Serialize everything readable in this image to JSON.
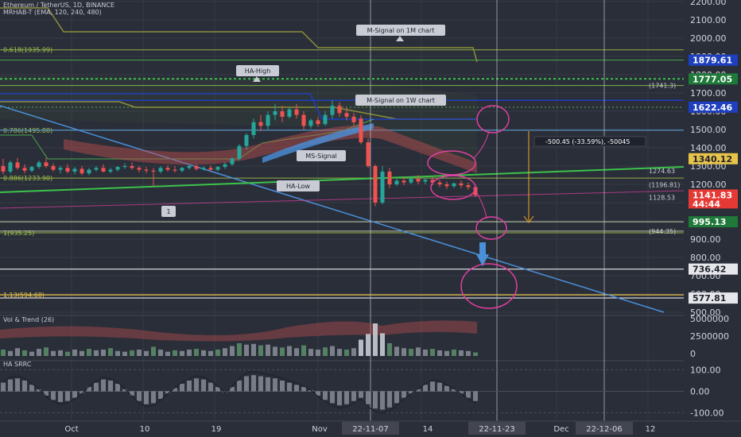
{
  "header": {
    "title": "Ethereum / TetherUS, 1D, BINANCE",
    "indicator": "MRHAB-T (EMA, 120, 240, 480)"
  },
  "colors": {
    "bg": "#2a2e39",
    "up": "#26a69a",
    "down": "#ef5350",
    "grid": "#363a45",
    "fib": "#a5c64a",
    "gold": "#e8c34a",
    "blue": "#1e3fbf",
    "trend": "#4a90d9",
    "magenta": "#e040a0",
    "ma_green": "#3cc24a",
    "crosshair": "#c0c4cc"
  },
  "chart_data": [
    {
      "type": "candlestick",
      "title": "Ethereum / TetherUS, 1D, BINANCE",
      "y_ticks": [
        500,
        600,
        700,
        800,
        900,
        1000,
        1100,
        1200,
        1300,
        1400,
        1500,
        1600,
        1700,
        1800,
        1900,
        2000,
        2100,
        2200
      ],
      "y_tick_labels": [
        "500.00",
        "600.00",
        "700.00",
        "800.00",
        "900.00",
        "1000.00",
        "1100.00",
        "1200.00",
        "1300.00",
        "1400.00",
        "1500.00",
        "1600.00",
        "1700.00",
        "1800.00",
        "1900.00",
        "2000.00",
        "2100.00",
        "2200.00"
      ],
      "ylim": [
        500,
        2220
      ],
      "x_labels": [
        "Oct",
        "10",
        "19",
        "Nov",
        "14",
        "Dec",
        "12"
      ],
      "x_highlight_labels": [
        "22-11-07",
        "22-11-23",
        "22-12-06"
      ],
      "price_badges": [
        {
          "value": "1879.61",
          "style": "blue"
        },
        {
          "value": "1777.05",
          "style": "green"
        },
        {
          "value": "1622.46",
          "style": "blue"
        },
        {
          "value": "1340.12",
          "style": "gold"
        },
        {
          "value": "1141.83",
          "sub": "44:44",
          "style": "red"
        },
        {
          "value": "995.13",
          "style": "green"
        },
        {
          "value": "736.42",
          "style": "light"
        },
        {
          "value": "577.81",
          "style": "light"
        }
      ],
      "fib_levels": [
        {
          "label": "0.618(1935.99)",
          "value": 1936
        },
        {
          "label": "0.786(1495.88)",
          "value": 1496
        },
        {
          "label": "0.886(1233.90)",
          "value": 1234
        },
        {
          "label": "1(935.25)",
          "value": 935
        },
        {
          "label": "1.13(594.68)",
          "value": 595
        }
      ],
      "line_labels": [
        {
          "text": "(1741.3)",
          "value": 1741
        },
        {
          "text": "1274.63",
          "value": 1275
        },
        {
          "text": "(1196.81)",
          "value": 1197
        },
        {
          "text": "1128.53",
          "value": 1129
        },
        {
          "text": "(944.35)",
          "value": 944
        }
      ],
      "callouts": [
        "M-Signal on 1M chart",
        "HA-High",
        "M-Signal on 1W chart",
        "MS-Signal",
        "HA-Low",
        "1"
      ],
      "measure_label": "-500.45 (-33.59%), -50045",
      "candles": [
        {
          "o": 1300,
          "h": 1340,
          "c": 1270,
          "l": 1255
        },
        {
          "o": 1270,
          "h": 1330,
          "c": 1320,
          "l": 1260
        },
        {
          "o": 1320,
          "h": 1345,
          "c": 1290,
          "l": 1280
        },
        {
          "o": 1290,
          "h": 1310,
          "c": 1275,
          "l": 1260
        },
        {
          "o": 1275,
          "h": 1300,
          "c": 1295,
          "l": 1265
        },
        {
          "o": 1295,
          "h": 1330,
          "c": 1320,
          "l": 1285
        },
        {
          "o": 1320,
          "h": 1345,
          "c": 1300,
          "l": 1290
        },
        {
          "o": 1300,
          "h": 1315,
          "c": 1280,
          "l": 1270
        },
        {
          "o": 1280,
          "h": 1300,
          "c": 1290,
          "l": 1260
        },
        {
          "o": 1290,
          "h": 1310,
          "c": 1270,
          "l": 1260
        },
        {
          "o": 1270,
          "h": 1295,
          "c": 1285,
          "l": 1255
        },
        {
          "o": 1285,
          "h": 1300,
          "c": 1260,
          "l": 1250
        },
        {
          "o": 1260,
          "h": 1290,
          "c": 1280,
          "l": 1250
        },
        {
          "o": 1280,
          "h": 1300,
          "c": 1290,
          "l": 1270
        },
        {
          "o": 1290,
          "h": 1310,
          "c": 1270,
          "l": 1265
        },
        {
          "o": 1270,
          "h": 1290,
          "c": 1280,
          "l": 1260
        },
        {
          "o": 1280,
          "h": 1300,
          "c": 1295,
          "l": 1270
        },
        {
          "o": 1295,
          "h": 1315,
          "c": 1300,
          "l": 1285
        },
        {
          "o": 1300,
          "h": 1320,
          "c": 1290,
          "l": 1280
        },
        {
          "o": 1290,
          "h": 1300,
          "c": 1280,
          "l": 1265
        },
        {
          "o": 1280,
          "h": 1295,
          "c": 1275,
          "l": 1260
        },
        {
          "o": 1275,
          "h": 1290,
          "c": 1270,
          "l": 1190
        },
        {
          "o": 1270,
          "h": 1300,
          "c": 1290,
          "l": 1260
        },
        {
          "o": 1290,
          "h": 1305,
          "c": 1280,
          "l": 1270
        },
        {
          "o": 1280,
          "h": 1300,
          "c": 1275,
          "l": 1265
        },
        {
          "o": 1275,
          "h": 1295,
          "c": 1290,
          "l": 1265
        },
        {
          "o": 1290,
          "h": 1310,
          "c": 1300,
          "l": 1280
        },
        {
          "o": 1300,
          "h": 1310,
          "c": 1285,
          "l": 1275
        },
        {
          "o": 1285,
          "h": 1300,
          "c": 1290,
          "l": 1275
        },
        {
          "o": 1290,
          "h": 1305,
          "c": 1280,
          "l": 1270
        },
        {
          "o": 1280,
          "h": 1300,
          "c": 1295,
          "l": 1270
        },
        {
          "o": 1295,
          "h": 1320,
          "c": 1310,
          "l": 1285
        },
        {
          "o": 1310,
          "h": 1350,
          "c": 1340,
          "l": 1300
        },
        {
          "o": 1340,
          "h": 1420,
          "c": 1410,
          "l": 1330
        },
        {
          "o": 1410,
          "h": 1480,
          "c": 1470,
          "l": 1390
        },
        {
          "o": 1470,
          "h": 1560,
          "c": 1540,
          "l": 1450
        },
        {
          "o": 1540,
          "h": 1580,
          "c": 1520,
          "l": 1490
        },
        {
          "o": 1520,
          "h": 1600,
          "c": 1580,
          "l": 1500
        },
        {
          "o": 1580,
          "h": 1640,
          "c": 1600,
          "l": 1550
        },
        {
          "o": 1600,
          "h": 1630,
          "c": 1570,
          "l": 1540
        },
        {
          "o": 1570,
          "h": 1620,
          "c": 1610,
          "l": 1560
        },
        {
          "o": 1610,
          "h": 1640,
          "c": 1580,
          "l": 1560
        },
        {
          "o": 1580,
          "h": 1600,
          "c": 1520,
          "l": 1500
        },
        {
          "o": 1520,
          "h": 1560,
          "c": 1550,
          "l": 1505
        },
        {
          "o": 1550,
          "h": 1570,
          "c": 1530,
          "l": 1515
        },
        {
          "o": 1530,
          "h": 1600,
          "c": 1580,
          "l": 1520
        },
        {
          "o": 1580,
          "h": 1660,
          "c": 1630,
          "l": 1560
        },
        {
          "o": 1630,
          "h": 1650,
          "c": 1590,
          "l": 1570
        },
        {
          "o": 1590,
          "h": 1620,
          "c": 1570,
          "l": 1550
        },
        {
          "o": 1570,
          "h": 1590,
          "c": 1540,
          "l": 1520
        },
        {
          "o": 1560,
          "h": 1580,
          "c": 1430,
          "l": 1420
        },
        {
          "o": 1430,
          "h": 1450,
          "c": 1300,
          "l": 1290
        },
        {
          "o": 1300,
          "h": 1310,
          "c": 1100,
          "l": 1080
        },
        {
          "o": 1100,
          "h": 1300,
          "c": 1270,
          "l": 1090
        },
        {
          "o": 1270,
          "h": 1290,
          "c": 1200,
          "l": 1180
        },
        {
          "o": 1200,
          "h": 1230,
          "c": 1220,
          "l": 1190
        },
        {
          "o": 1220,
          "h": 1240,
          "c": 1210,
          "l": 1195
        },
        {
          "o": 1210,
          "h": 1240,
          "c": 1230,
          "l": 1200
        },
        {
          "o": 1230,
          "h": 1250,
          "c": 1215,
          "l": 1200
        },
        {
          "o": 1215,
          "h": 1235,
          "c": 1225,
          "l": 1200
        },
        {
          "o": 1225,
          "h": 1240,
          "c": 1210,
          "l": 1195
        },
        {
          "o": 1210,
          "h": 1225,
          "c": 1200,
          "l": 1185
        },
        {
          "o": 1200,
          "h": 1215,
          "c": 1190,
          "l": 1175
        },
        {
          "o": 1190,
          "h": 1210,
          "c": 1205,
          "l": 1180
        },
        {
          "o": 1205,
          "h": 1220,
          "c": 1195,
          "l": 1180
        },
        {
          "o": 1195,
          "h": 1210,
          "c": 1185,
          "l": 1170
        },
        {
          "o": 1185,
          "h": 1200,
          "c": 1141,
          "l": 1130
        }
      ]
    },
    {
      "type": "bar",
      "title": "Vol & Trend (26)",
      "y_tick_labels": [
        "5000000",
        "2500000",
        "0"
      ],
      "ylim": [
        0,
        5500000
      ],
      "values": [
        900000,
        700000,
        1100000,
        800000,
        600000,
        1000000,
        1200000,
        700000,
        800000,
        600000,
        900000,
        700000,
        1000000,
        800000,
        900000,
        1100000,
        700000,
        600000,
        800000,
        900000,
        700000,
        1300000,
        900000,
        600000,
        800000,
        700000,
        900000,
        1000000,
        800000,
        700000,
        900000,
        1100000,
        1400000,
        1800000,
        1600000,
        1700000,
        1500000,
        1600000,
        1300000,
        1200000,
        1400000,
        1100000,
        1500000,
        1000000,
        900000,
        1200000,
        1400000,
        1000000,
        900000,
        1100000,
        2300000,
        3100000,
        4600000,
        3200000,
        1800000,
        1300000,
        1100000,
        1000000,
        1200000,
        900000,
        1000000,
        800000,
        700000,
        900000,
        800000,
        700000,
        500000
      ]
    },
    {
      "type": "bar",
      "title": "HA SRRC",
      "y_tick_labels": [
        "100.00",
        "0.00",
        "-100.00"
      ],
      "ylim": [
        -120,
        120
      ],
      "values": [
        40,
        55,
        60,
        50,
        30,
        10,
        -20,
        -40,
        -50,
        -45,
        -30,
        -10,
        20,
        40,
        55,
        50,
        35,
        10,
        -20,
        -45,
        -60,
        -55,
        -35,
        -10,
        15,
        35,
        50,
        60,
        55,
        40,
        20,
        -5,
        20,
        50,
        70,
        75,
        70,
        65,
        60,
        50,
        40,
        30,
        20,
        5,
        -20,
        -40,
        -55,
        -65,
        -60,
        -45,
        -30,
        -60,
        -80,
        -85,
        -75,
        -55,
        -30,
        -10,
        10,
        30,
        45,
        40,
        25,
        10,
        -10,
        -30,
        -45
      ]
    }
  ]
}
